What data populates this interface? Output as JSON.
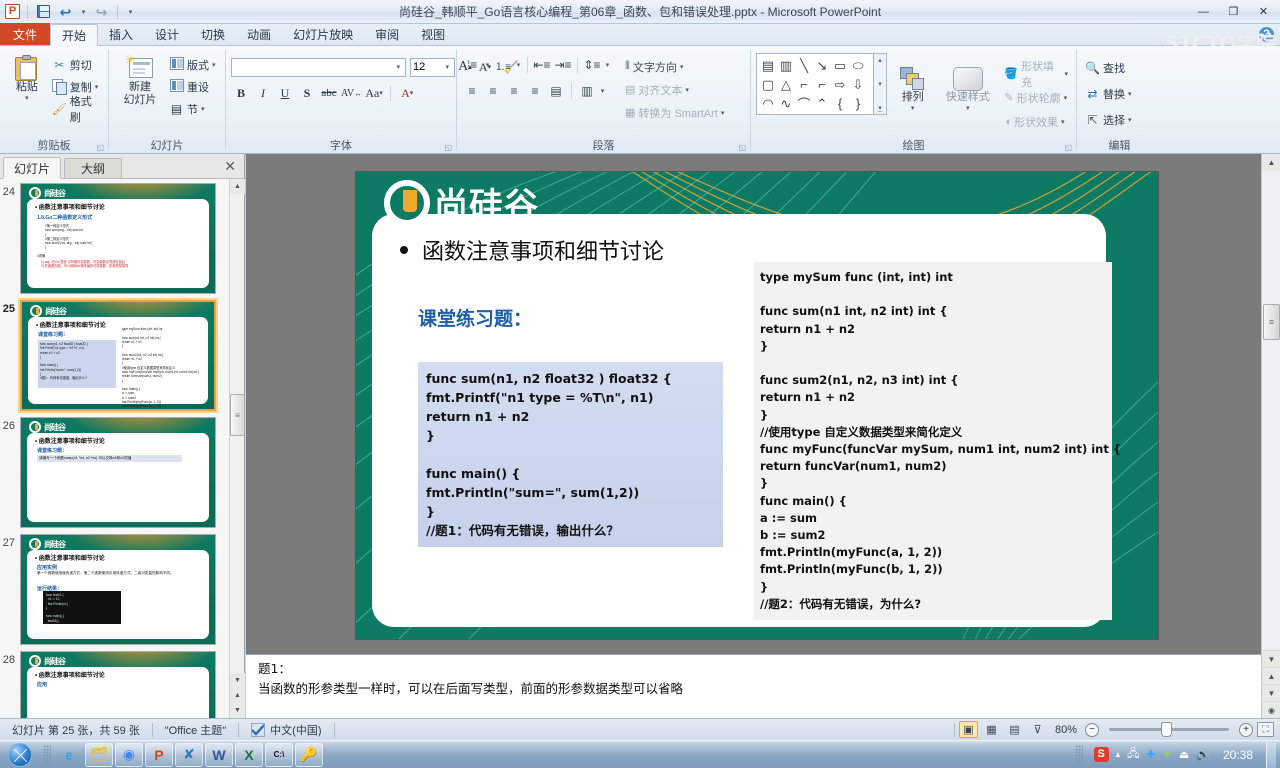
{
  "window": {
    "title": "尚硅谷_韩顺平_Go语言核心编程_第06章_函数、包和错误处理.pptx  -  Microsoft PowerPoint",
    "app_logo": "P",
    "minimize": "—",
    "restore": "❐",
    "close": "✕",
    "help": "?"
  },
  "quick_access": {
    "save": "save-icon",
    "undo": "↩",
    "redo": "↪",
    "customize": "▾"
  },
  "watermark": "51CTO学院",
  "ribbon_tabs": [
    {
      "label": "文件",
      "active": false,
      "file": true
    },
    {
      "label": "开始",
      "active": true
    },
    {
      "label": "插入",
      "active": false
    },
    {
      "label": "设计",
      "active": false
    },
    {
      "label": "切换",
      "active": false
    },
    {
      "label": "动画",
      "active": false
    },
    {
      "label": "幻灯片放映",
      "active": false
    },
    {
      "label": "审阅",
      "active": false
    },
    {
      "label": "视图",
      "active": false
    }
  ],
  "ribbon": {
    "clipboard": {
      "label": "剪贴板",
      "paste": "粘贴",
      "cut": "剪切",
      "copy": "复制",
      "format_painter": "格式刷",
      "caret": "▾"
    },
    "slides": {
      "label": "幻灯片",
      "new_slide_line1": "新建",
      "new_slide_line2": "幻灯片",
      "layout": "版式",
      "reset": "重设",
      "section": "节",
      "caret": "▾"
    },
    "font": {
      "label": "字体",
      "font_name_value": "",
      "font_size_value": "12",
      "grow": "A",
      "shrink": "A",
      "clear_format": "clear-formatting-icon",
      "bold": "B",
      "italic": "I",
      "underline": "U",
      "shadow": "S",
      "strikethrough": "abc",
      "char_spacing": "AV",
      "change_case": "Aa",
      "font_color": "A",
      "caret": "▾"
    },
    "paragraph": {
      "label": "段落",
      "bullets": "bullet-list-icon",
      "numbering": "numbered-list-icon",
      "decrease_indent": "decrease-indent-icon",
      "increase_indent": "increase-indent-icon",
      "line_spacing": "line-spacing-icon",
      "align_left": "align-left-icon",
      "align_center": "align-center-icon",
      "align_right": "align-right-icon",
      "justify": "justify-icon",
      "distribute": "distribute-icon",
      "columns": "columns-icon",
      "text_direction": "文字方向",
      "align_text": "对齐文本",
      "smartart": "转换为 SmartArt",
      "caret": "▾"
    },
    "drawing": {
      "label": "绘图",
      "arrange": "排列",
      "quick_styles": "快速样式",
      "shape_fill": "形状填充",
      "shape_outline": "形状轮廓",
      "shape_effects": "形状效果",
      "shapes": [
        "▤",
        "▥",
        "╲",
        "↘",
        "▭",
        "⬭",
        "▢",
        "△",
        "⌐",
        "⌐",
        "⇨",
        "⇩",
        "◠",
        "∿",
        "⌒",
        "⌃",
        "{",
        "}"
      ],
      "caret": "▾"
    },
    "editing": {
      "label": "编辑",
      "find": "查找",
      "replace": "替换",
      "select": "选择",
      "caret": "▾"
    }
  },
  "left_panel": {
    "tabs": [
      {
        "label": "幻灯片",
        "active": true
      },
      {
        "label": "大纲",
        "active": false
      }
    ],
    "close": "✕",
    "thumbnails": [
      {
        "number": "24",
        "selected": false,
        "kind": "code-red"
      },
      {
        "number": "25",
        "selected": true,
        "kind": "two-code"
      },
      {
        "number": "26",
        "selected": false,
        "kind": "one-line"
      },
      {
        "number": "27",
        "selected": false,
        "kind": "terminal"
      },
      {
        "number": "28",
        "selected": false,
        "kind": "partial"
      }
    ],
    "thumb_mini": {
      "logo_text": "尚硅谷",
      "title": "函数注意事项和细节讨论",
      "blue_sub": "课堂练习题："
    }
  },
  "slide": {
    "logo_text": "尚硅谷",
    "title": "函数注意事项和细节讨论",
    "subtitle": "课堂练习题：",
    "code_left": "func sum(n1, n2 float32 ) float32 {\nfmt.Printf(\"n1 type = %T\\n\", n1)\nreturn n1 + n2\n}\n\nfunc main() {\nfmt.Println(\"sum=\", sum(1,2))\n}\n//题1：代码有无错误，输出什么？",
    "code_right": "type mySum func (int, int) int\n\nfunc sum(n1 int, n2 int) int {\nreturn n1 + n2\n}\n\nfunc sum2(n1, n2, n3 int) int {\nreturn n1 + n2\n}\n//使用type 自定义数据类型来简化定义\nfunc myFunc(funcVar mySum, num1 int, num2 int) int {\nreturn funcVar(num1, num2)\n}\nfunc main() {\na := sum\nb := sum2\nfmt.Println(myFunc(a, 1, 2))\nfmt.Println(myFunc(b, 1, 2))\n}\n//题2：代码有无错误，为什么?"
  },
  "notes": {
    "line1": "题1：",
    "line2": "当函数的形参类型一样时，可以在后面写类型，前面的形参数据类型可以省略"
  },
  "status_bar": {
    "slide_counter": "幻灯片 第 25 张，共 59 张",
    "theme": "\"Office 主题\"",
    "language": "中文(中国)",
    "spellcheck_icon": "spellcheck-icon",
    "views": [
      {
        "name": "normal-view",
        "glyph": "▣",
        "active": true
      },
      {
        "name": "slide-sorter-view",
        "glyph": "▦",
        "active": false
      },
      {
        "name": "reading-view",
        "glyph": "▤",
        "active": false
      },
      {
        "name": "slideshow-view",
        "glyph": "⊽",
        "active": false
      }
    ],
    "zoom_level": "80%",
    "zoom_out": "−",
    "zoom_in": "+",
    "fit_to_window": "⛶"
  },
  "taskbar": {
    "start": "start-orb",
    "items": [
      {
        "name": "internet-explorer",
        "glyph": "e",
        "color": "#3aa0dd",
        "boxed": false
      },
      {
        "name": "file-explorer",
        "glyph": "🗂",
        "color": "#e8b84b",
        "boxed": true
      },
      {
        "name": "google-chrome",
        "glyph": "◉",
        "color": "#4285f4",
        "boxed": true
      },
      {
        "name": "powerpoint",
        "glyph": "P",
        "color": "#d24726",
        "boxed": true
      },
      {
        "name": "visual-studio-code",
        "glyph": "✘",
        "color": "#2e7fc1",
        "boxed": true
      },
      {
        "name": "microsoft-word",
        "glyph": "W",
        "color": "#2b579a",
        "boxed": true
      },
      {
        "name": "microsoft-excel",
        "glyph": "X",
        "color": "#1e7145",
        "boxed": true
      },
      {
        "name": "command-prompt",
        "glyph": "C:\\",
        "color": "#111111",
        "boxed": true
      },
      {
        "name": "other-app",
        "glyph": "🔑",
        "color": "#444444",
        "boxed": true
      }
    ],
    "tray": {
      "sogou_ime": "S",
      "show_hidden": "▴",
      "network": "network-icon",
      "bluetooth": "bluetooth-icon",
      "security": "security-icon",
      "safe_remove": "safe-remove-icon",
      "volume": "volume-icon",
      "clock": "20:38"
    }
  }
}
